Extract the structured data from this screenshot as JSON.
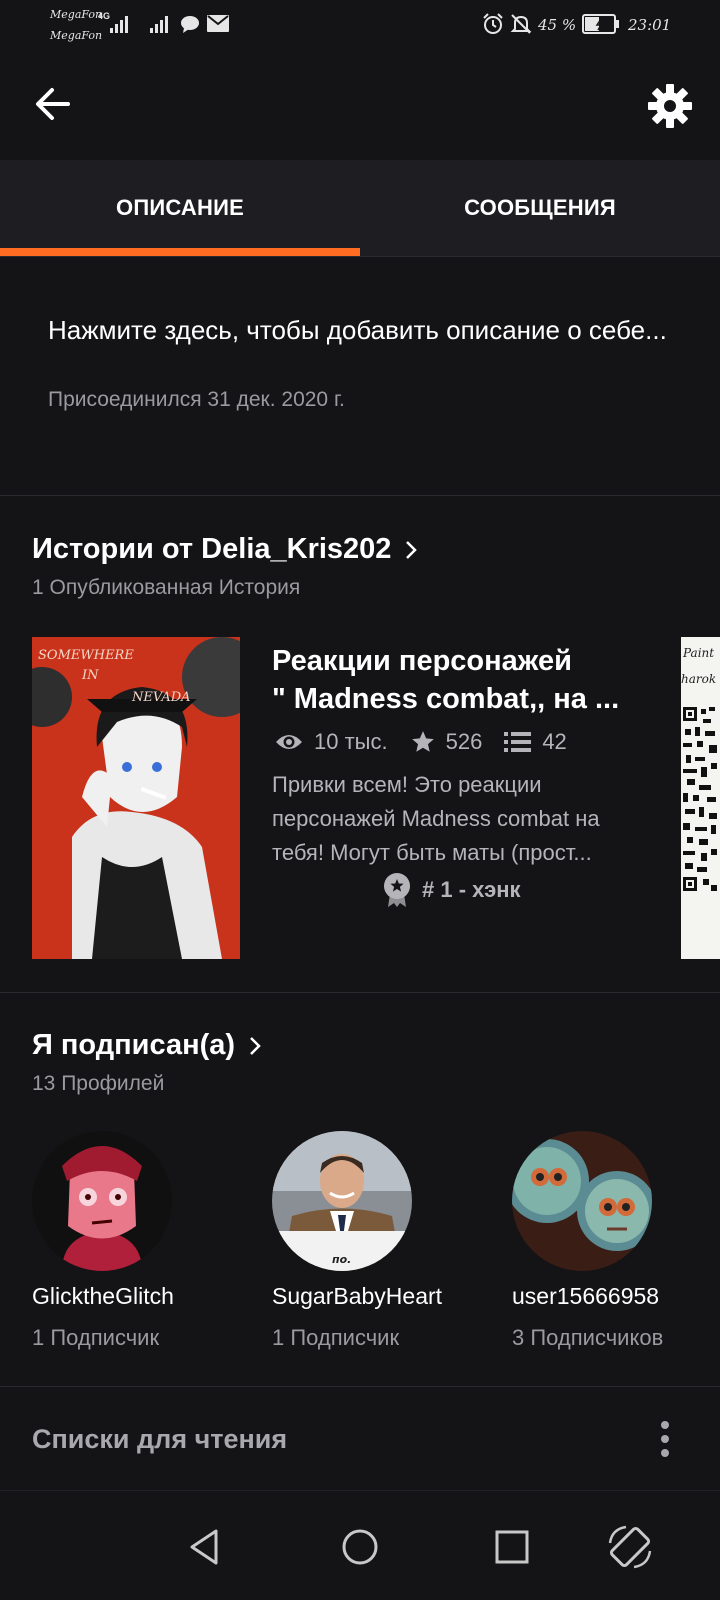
{
  "status_bar": {
    "carrier_1": "MegaFon",
    "carrier_2": "MegaFon",
    "network_type": "4G",
    "battery": "45 %",
    "time": "23:01",
    "icons": [
      "signal-icon",
      "chat-icon",
      "mail-icon",
      "alarm-icon",
      "mute-icon",
      "battery-icon"
    ]
  },
  "toolbar": {
    "back_icon": "arrow-left-icon",
    "settings_icon": "gear-icon"
  },
  "tabs": [
    {
      "label": "ОПИСАНИЕ",
      "active": true
    },
    {
      "label": "СООБЩЕНИЯ",
      "active": false
    }
  ],
  "accent_color": "#ff6c22",
  "about": {
    "placeholder": "Нажмите здесь, чтобы добавить описание о себе...",
    "joined": "Присоединился 31 дек. 2020 г."
  },
  "stories": {
    "title": "Истории от Delia_Kris202",
    "subtitle": "1 Опубликованная История",
    "items": [
      {
        "title_line1": "Реакции персонажей",
        "title_line2": "\" Madness combat,, на ...",
        "reads": "10 тыс.",
        "votes": "526",
        "parts": "42",
        "desc_line1": "Привки всем! Это реакции",
        "desc_line2": "персонажей Madness combat на",
        "desc_line3": "тебя! Могут быть маты (прост...",
        "rank": "# 1 - хэнк",
        "cover_text_1": "SOMEWHERE",
        "cover_text_2": "IN",
        "cover_text_3": "NEVADA"
      }
    ],
    "next_cover_text_1": "Paint",
    "next_cover_text_2": "harok"
  },
  "following": {
    "title": "Я подписан(а)",
    "subtitle": "13 Профилей",
    "profiles": [
      {
        "name": "GlicktheGlitch",
        "followers": "1 Подписчик"
      },
      {
        "name": "SugarBabyHeart",
        "followers": "1 Подписчик",
        "sign_text": "по."
      },
      {
        "name": "user15666958",
        "followers": "3 Подписчиков"
      }
    ]
  },
  "reading_lists": {
    "title": "Списки для чтения"
  },
  "nav": {
    "icons": [
      "back-triangle-icon",
      "home-circle-icon",
      "recents-square-icon",
      "rotate-icon"
    ]
  }
}
